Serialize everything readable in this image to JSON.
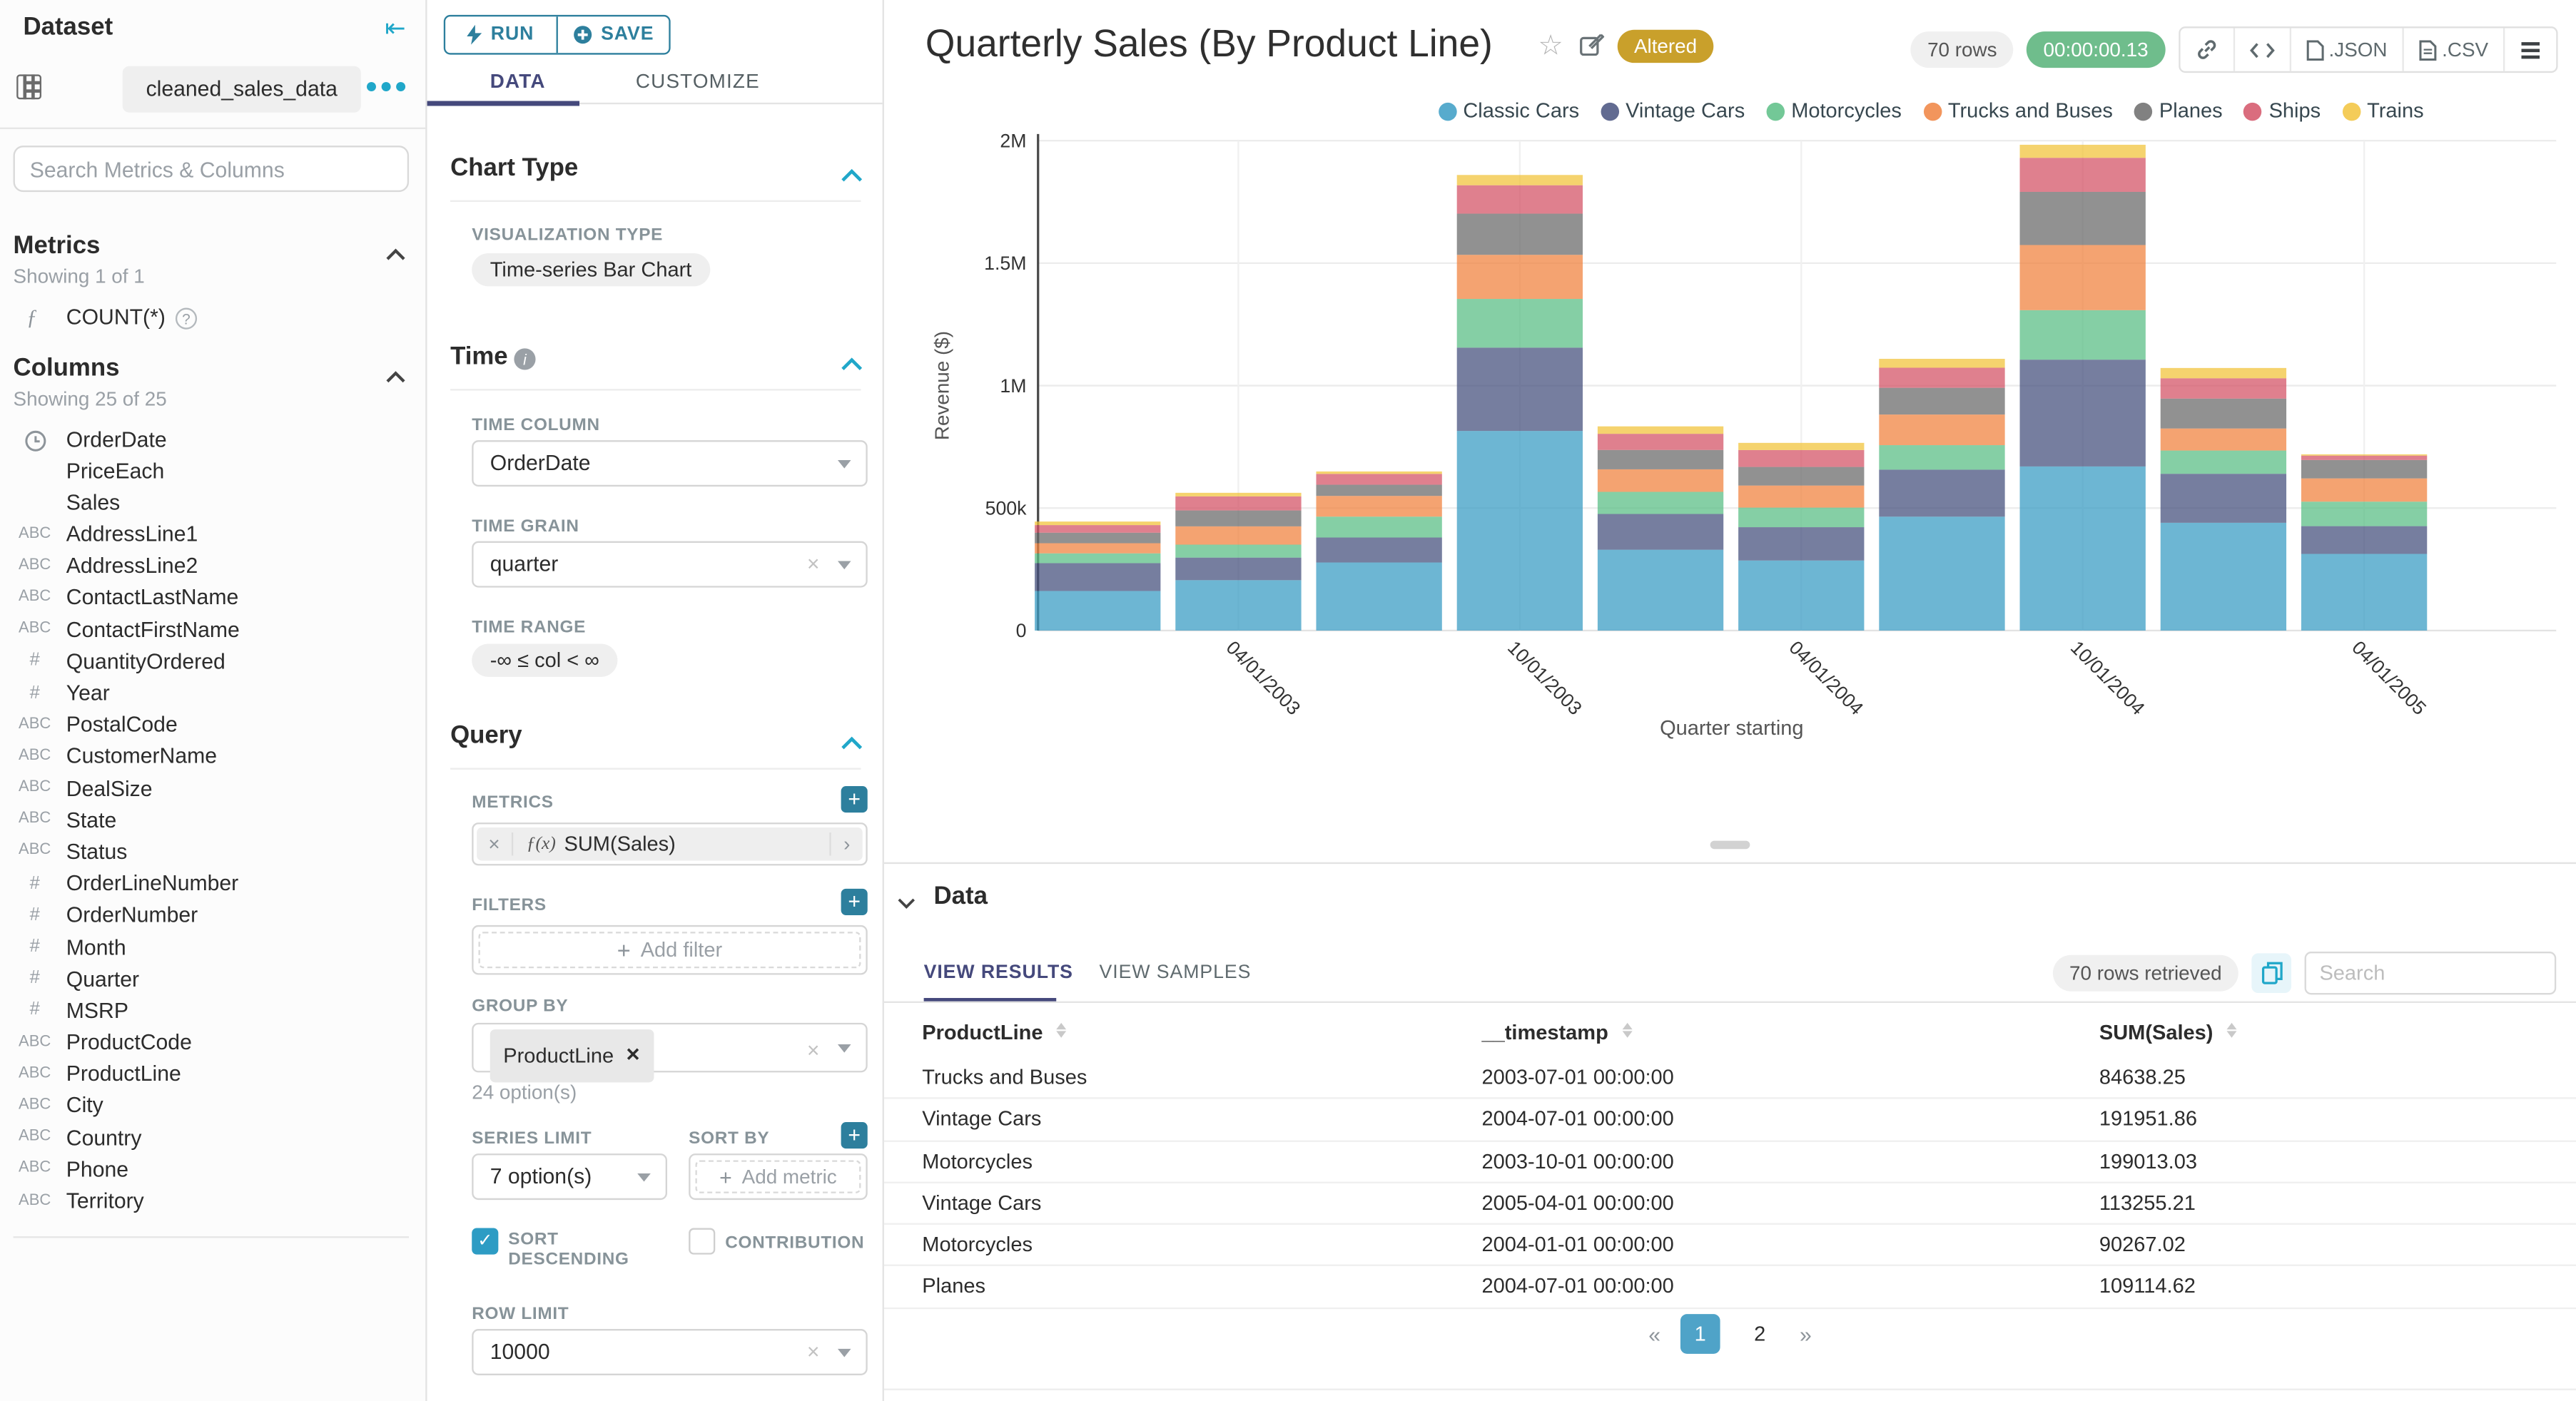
{
  "dataset_panel": {
    "title": "Dataset",
    "dataset_name": "cleaned_sales_data",
    "search_placeholder": "Search Metrics & Columns",
    "metrics_section": {
      "title": "Metrics",
      "showing": "Showing 1 of 1",
      "items": [
        {
          "icon": "function-icon",
          "label": "COUNT(*)",
          "help_icon": "?"
        }
      ]
    },
    "columns_section": {
      "title": "Columns",
      "showing": "Showing 25 of 25",
      "items": [
        {
          "type": "time",
          "label": "OrderDate"
        },
        {
          "type": "plain",
          "label": "PriceEach"
        },
        {
          "type": "plain",
          "label": "Sales"
        },
        {
          "type": "text",
          "label": "AddressLine1"
        },
        {
          "type": "text",
          "label": "AddressLine2"
        },
        {
          "type": "text",
          "label": "ContactLastName"
        },
        {
          "type": "text",
          "label": "ContactFirstName"
        },
        {
          "type": "num",
          "label": "QuantityOrdered"
        },
        {
          "type": "num",
          "label": "Year"
        },
        {
          "type": "text",
          "label": "PostalCode"
        },
        {
          "type": "text",
          "label": "CustomerName"
        },
        {
          "type": "text",
          "label": "DealSize"
        },
        {
          "type": "text",
          "label": "State"
        },
        {
          "type": "text",
          "label": "Status"
        },
        {
          "type": "num",
          "label": "OrderLineNumber"
        },
        {
          "type": "num",
          "label": "OrderNumber"
        },
        {
          "type": "num",
          "label": "Month"
        },
        {
          "type": "num",
          "label": "Quarter"
        },
        {
          "type": "num",
          "label": "MSRP"
        },
        {
          "type": "text",
          "label": "ProductCode"
        },
        {
          "type": "text",
          "label": "ProductLine"
        },
        {
          "type": "text",
          "label": "City"
        },
        {
          "type": "text",
          "label": "Country"
        },
        {
          "type": "text",
          "label": "Phone"
        },
        {
          "type": "text",
          "label": "Territory"
        }
      ]
    }
  },
  "control_panel": {
    "run_label": "RUN",
    "save_label": "SAVE",
    "tabs": {
      "data": "DATA",
      "customize": "CUSTOMIZE",
      "active": "DATA"
    },
    "chart_type": {
      "title": "Chart Type",
      "viz_label": "VISUALIZATION TYPE",
      "viz_value": "Time-series Bar Chart"
    },
    "time": {
      "title": "Time",
      "column_label": "TIME COLUMN",
      "column_value": "OrderDate",
      "grain_label": "TIME GRAIN",
      "grain_value": "quarter",
      "range_label": "TIME RANGE",
      "range_value": "-∞ ≤ col < ∞"
    },
    "query": {
      "title": "Query",
      "metrics_label": "METRICS",
      "metric_fx": "ƒ(x)",
      "metric_value": "SUM(Sales)",
      "filters_label": "FILTERS",
      "add_filter": "Add filter",
      "group_by_label": "GROUP BY",
      "group_by_value": "ProductLine",
      "group_by_options": "24 option(s)",
      "series_limit_label": "SERIES LIMIT",
      "series_limit_value": "7 option(s)",
      "sort_by_label": "SORT BY",
      "add_metric": "Add metric",
      "sort_descending_label": "SORT DESCENDING",
      "contribution_label": "CONTRIBUTION",
      "row_limit_label": "ROW LIMIT",
      "row_limit_value": "10000"
    }
  },
  "header": {
    "title": "Quarterly Sales (By Product Line)",
    "altered_badge": "Altered",
    "rows_pill": "70 rows",
    "timer": "00:00:00.13",
    "export_json": ".JSON",
    "export_csv": ".CSV"
  },
  "chart_data": {
    "type": "bar",
    "stacked": true,
    "xlabel": "Quarter starting",
    "ylabel": "Revenue ($)",
    "ylim": [
      0,
      2000000
    ],
    "ytick_values": [
      0,
      500000,
      1000000,
      1500000,
      2000000
    ],
    "ytick_labels": [
      "0",
      "500k",
      "1M",
      "1.5M",
      "2M"
    ],
    "grid": true,
    "legend_position": "top-right",
    "categories": [
      "2003-01-01",
      "2003-04-01",
      "2003-07-01",
      "2003-10-01",
      "2004-01-01",
      "2004-04-01",
      "2004-07-01",
      "2004-10-01",
      "2005-01-01",
      "2005-04-01"
    ],
    "x_tick_labels": [
      {
        "index": 1,
        "label": "04/01/2003"
      },
      {
        "index": 3,
        "label": "10/01/2003"
      },
      {
        "index": 5,
        "label": "04/01/2004"
      },
      {
        "index": 7,
        "label": "10/01/2004"
      },
      {
        "index": 9,
        "label": "04/01/2005"
      }
    ],
    "series": [
      {
        "name": "Classic Cars",
        "color": "#3A9CC4",
        "values": [
          161600,
          205700,
          277900,
          815000,
          330000,
          286000,
          465000,
          670000,
          440000,
          313000
        ]
      },
      {
        "name": "Vintage Cars",
        "color": "#46517E",
        "values": [
          113600,
          92200,
          102000,
          340000,
          146000,
          136000,
          191952,
          436000,
          200000,
          113255
        ]
      },
      {
        "name": "Motorcycles",
        "color": "#5BBE85",
        "values": [
          40000,
          52900,
          85200,
          199013,
          90267,
          80000,
          100000,
          202000,
          95000,
          100000
        ]
      },
      {
        "name": "Trucks and Buses",
        "color": "#F0833F",
        "values": [
          41400,
          74600,
          84638,
          180000,
          92000,
          90000,
          125000,
          266000,
          90000,
          95000
        ]
      },
      {
        "name": "Planes",
        "color": "#6B6B6B",
        "values": [
          42900,
          65000,
          45600,
          168000,
          79000,
          76000,
          109115,
          217000,
          122000,
          75000
        ]
      },
      {
        "name": "Ships",
        "color": "#D45467",
        "values": [
          31100,
          57400,
          44300,
          116000,
          66000,
          69000,
          82000,
          139000,
          83000,
          18000
        ]
      },
      {
        "name": "Trains",
        "color": "#F2C33C",
        "values": [
          14500,
          14600,
          9900,
          42000,
          30400,
          29300,
          36300,
          53300,
          42000,
          5200
        ]
      }
    ]
  },
  "data_panel": {
    "title": "Data",
    "tabs": {
      "results": "VIEW RESULTS",
      "samples": "VIEW SAMPLES",
      "active": "VIEW RESULTS"
    },
    "rows_retrieved": "70 rows retrieved",
    "search_placeholder": "Search",
    "table": {
      "headers": [
        "ProductLine",
        "__timestamp",
        "SUM(Sales)"
      ],
      "rows": [
        [
          "Trucks and Buses",
          "2003-07-01 00:00:00",
          "84638.25"
        ],
        [
          "Vintage Cars",
          "2004-07-01 00:00:00",
          "191951.86"
        ],
        [
          "Motorcycles",
          "2003-10-01 00:00:00",
          "199013.03"
        ],
        [
          "Vintage Cars",
          "2005-04-01 00:00:00",
          "113255.21"
        ],
        [
          "Motorcycles",
          "2004-01-01 00:00:00",
          "90267.02"
        ],
        [
          "Planes",
          "2004-07-01 00:00:00",
          "109114.62"
        ]
      ]
    },
    "pagination": {
      "prev": "«",
      "pages": [
        "1",
        "2"
      ],
      "active": "1",
      "next": "»"
    }
  },
  "colors": {
    "accent_teal": "#20a7c9",
    "button_teal": "#2d7f9d",
    "active_tab_navy": "#45497c",
    "altered_gold": "#c9a02b",
    "timer_green": "#6fbd8c",
    "active_page_blue": "#4fa3c8",
    "bar_opacity": 0.74
  }
}
